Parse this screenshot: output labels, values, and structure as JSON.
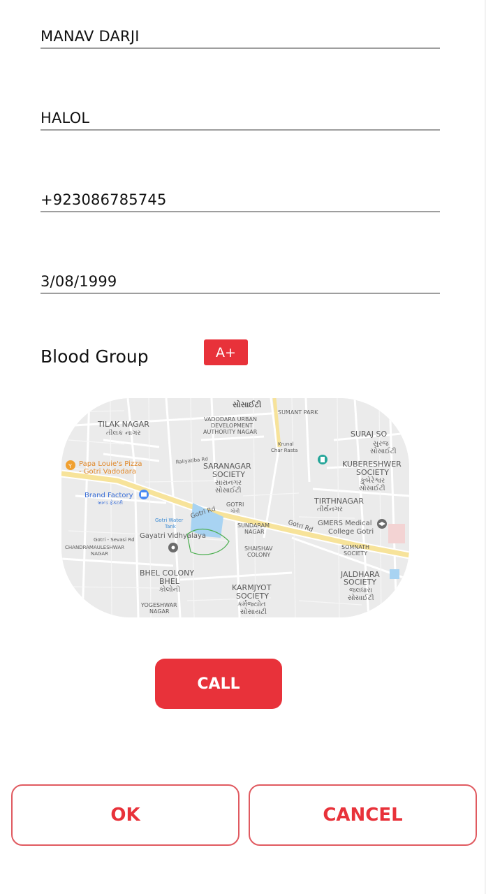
{
  "form": {
    "name": "MANAV DARJI",
    "city": "HALOL",
    "phone": "+923086785745",
    "dob": "3/08/1999",
    "blood_group_label": "Blood Group",
    "blood_group_value": "A+"
  },
  "map": {
    "labels": [
      {
        "id": "tilak",
        "text": "TILAK NAGAR"
      },
      {
        "id": "tilak_gu",
        "text": "તીલક નાગર"
      },
      {
        "id": "vuda1",
        "text": "VADODARA URBAN"
      },
      {
        "id": "vuda2",
        "text": "DEVELOPMENT"
      },
      {
        "id": "vuda3",
        "text": "AUTHORITY NAGAR"
      },
      {
        "id": "sumant",
        "text": "SUMANT PARK"
      },
      {
        "id": "suraj",
        "text": "SURAJ SO"
      },
      {
        "id": "suraj_gu",
        "text": "સુરજ"
      },
      {
        "id": "suraj_gu2",
        "text": "સોસાઈટી"
      },
      {
        "id": "top_gu",
        "text": "સોસાઈટી"
      },
      {
        "id": "krunal1",
        "text": "Krunal"
      },
      {
        "id": "krunal2",
        "text": "Char Rasta"
      },
      {
        "id": "papa1",
        "text": "Papa Louie's Pizza"
      },
      {
        "id": "papa2",
        "text": "- Gotri Vadodara"
      },
      {
        "id": "raliyatiba",
        "text": "Raliyatiba Rd"
      },
      {
        "id": "saranagar1",
        "text": "SARANAGAR"
      },
      {
        "id": "saranagar2",
        "text": "SOCIETY"
      },
      {
        "id": "saranagar_gu1",
        "text": "સારાનગર"
      },
      {
        "id": "saranagar_gu2",
        "text": "સોસાઈટી"
      },
      {
        "id": "kuber1",
        "text": "KUBERESHWER"
      },
      {
        "id": "kuber2",
        "text": "SOCIETY"
      },
      {
        "id": "kuber_gu1",
        "text": "કુબેરેશ્વર"
      },
      {
        "id": "kuber_gu2",
        "text": "સોસાઈટી"
      },
      {
        "id": "brand",
        "text": "Brand Factory"
      },
      {
        "id": "brand_gu",
        "text": "બ્રાન્ડ ફેક્ટરી"
      },
      {
        "id": "tirth",
        "text": "TIRTHNAGAR"
      },
      {
        "id": "tirth_gu",
        "text": "તીર્થનગર"
      },
      {
        "id": "gotrird1",
        "text": "Gotri Rd"
      },
      {
        "id": "gotrird2",
        "text": "Gotri Rd"
      },
      {
        "id": "gotri",
        "text": "GOTRI"
      },
      {
        "id": "gotri_gu",
        "text": "ગોત્રી"
      },
      {
        "id": "tank1",
        "text": "Gotri Water"
      },
      {
        "id": "tank2",
        "text": "Tank"
      },
      {
        "id": "gayatri",
        "text": "Gayatri Vidhyalaya"
      },
      {
        "id": "sundaram1",
        "text": "SUNDARAM"
      },
      {
        "id": "sundaram2",
        "text": "NAGAR"
      },
      {
        "id": "gmers1",
        "text": "GMERS Medical"
      },
      {
        "id": "gmers2",
        "text": "College Gotri"
      },
      {
        "id": "sevasi",
        "text": "Gotri - Sevasi Rd"
      },
      {
        "id": "chandra1",
        "text": "CHANDRAMAULESHWAR"
      },
      {
        "id": "chandra2",
        "text": "NAGAR"
      },
      {
        "id": "shaishav1",
        "text": "SHAISHAV"
      },
      {
        "id": "shaishav2",
        "text": "COLONY"
      },
      {
        "id": "somnath1",
        "text": "SOMNATH"
      },
      {
        "id": "somnath2",
        "text": "SOCIETY"
      },
      {
        "id": "bhel1",
        "text": "BHEL COLONY"
      },
      {
        "id": "bhel2",
        "text": "BHEL"
      },
      {
        "id": "bhel_gu",
        "text": "કોલોની"
      },
      {
        "id": "jaldhara1",
        "text": "JALDHARA"
      },
      {
        "id": "jaldhara2",
        "text": "SOCIETY"
      },
      {
        "id": "jaldhara_gu1",
        "text": "જલધારા"
      },
      {
        "id": "jaldhara_gu2",
        "text": "સોસાઈટી"
      },
      {
        "id": "karm1",
        "text": "KARMJYOT"
      },
      {
        "id": "karm2",
        "text": "SOCIETY"
      },
      {
        "id": "karm_gu1",
        "text": "કર્મજ્યોત"
      },
      {
        "id": "karm_gu2",
        "text": "સોસાયટી"
      },
      {
        "id": "yogesh1",
        "text": "YOGESHWAR"
      },
      {
        "id": "yogesh2",
        "text": "NAGAR"
      }
    ]
  },
  "actions": {
    "call_label": "CALL",
    "ok_label": "OK",
    "cancel_label": "CANCEL"
  },
  "colors": {
    "accent": "#e8323a",
    "underline": "#9e9e9e",
    "road_major": "#f7e39a",
    "water": "#a8d3f2",
    "map_bg": "#e9e9e9"
  }
}
